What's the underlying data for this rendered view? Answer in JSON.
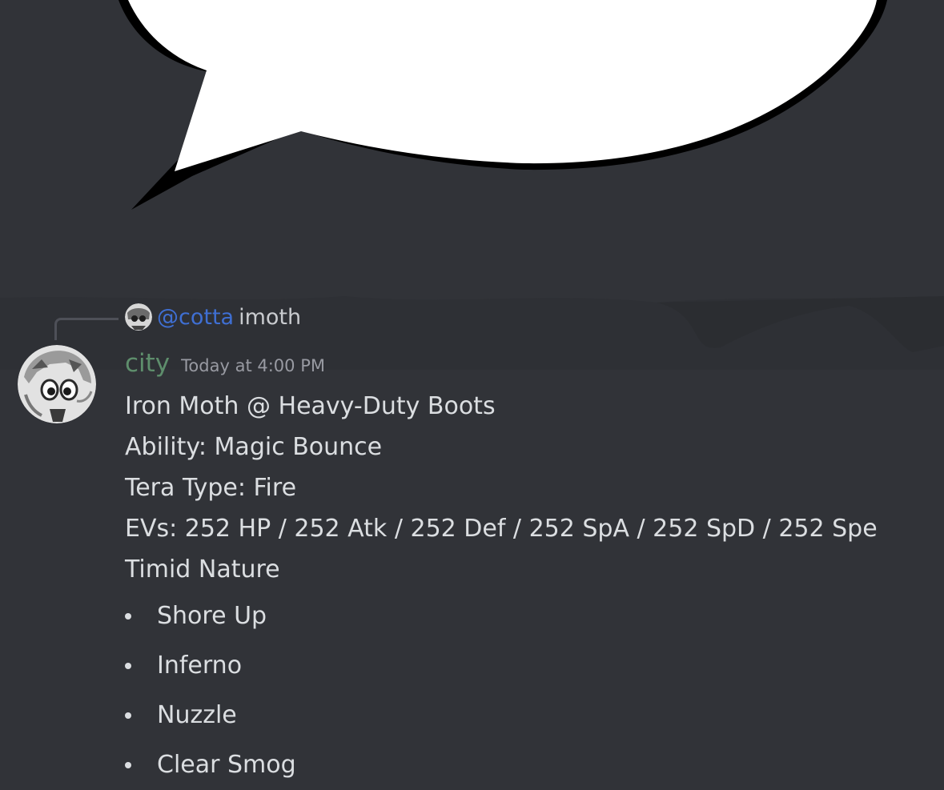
{
  "reply": {
    "mention": "@cotta",
    "text": "imoth"
  },
  "message": {
    "author": "city",
    "timestamp": "Today at 4:00 PM",
    "lines": [
      "Iron Moth @ Heavy-Duty Boots",
      "Ability: Magic Bounce",
      "Tera Type: Fire",
      "EVs: 252 HP / 252 Atk / 252 Def / 252 SpA / 252 SpD / 252 Spe",
      "Timid Nature"
    ],
    "moves": [
      "Shore Up",
      "Inferno",
      "Nuzzle",
      "Clear Smog"
    ]
  },
  "colors": {
    "background": "#313338",
    "username": "#5e8e6c",
    "mention": "#3f6fd3",
    "timestamp": "#989aa2",
    "text": "#dbdee1"
  }
}
